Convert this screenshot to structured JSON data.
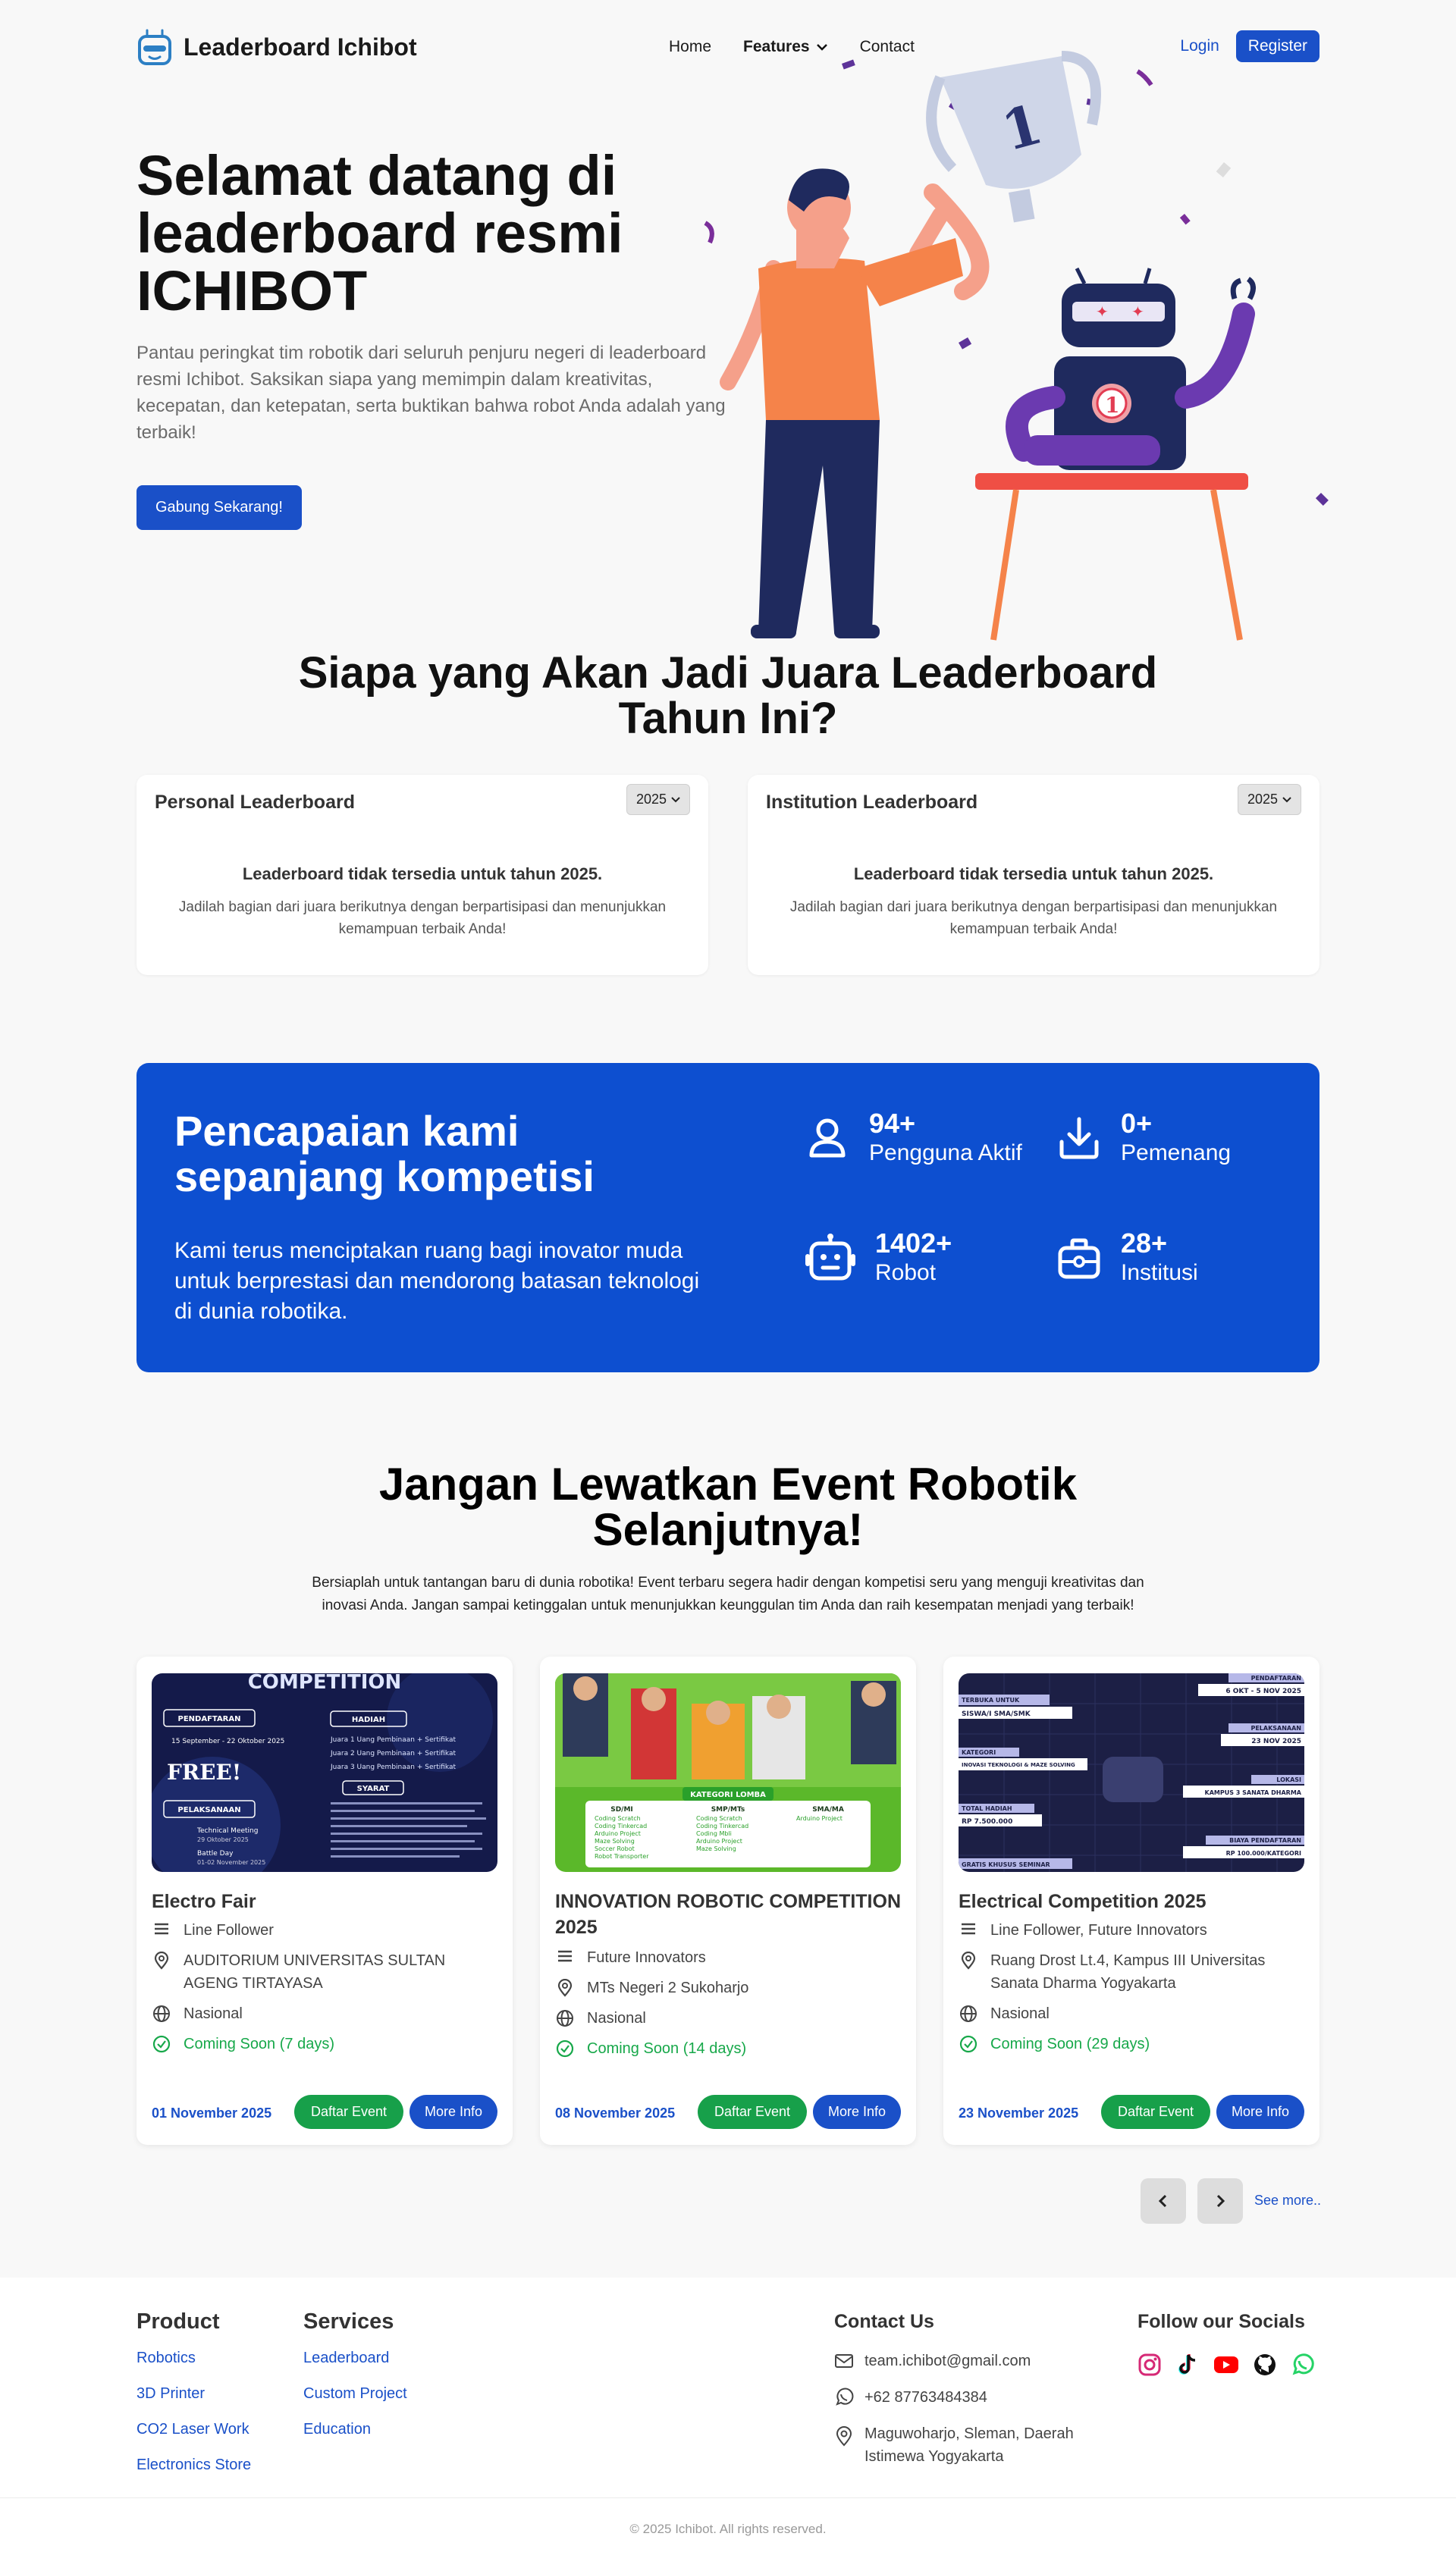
{
  "nav": {
    "brand": "Leaderboard Ichibot",
    "home": "Home",
    "features": "Features",
    "contact": "Contact",
    "login": "Login",
    "register": "Register"
  },
  "hero": {
    "title": "Selamat datang di leaderboard resmi ICHIBOT",
    "description": "Pantau peringkat tim robotik dari seluruh penjuru negeri di leaderboard resmi Ichibot. Saksikan siapa yang memimpin dalam kreativitas, kecepatan, dan ketepatan, serta buktikan bahwa robot Anda adalah yang terbaik!",
    "cta": "Gabung Sekarang!",
    "trophy_number": "1",
    "badge_number": "1"
  },
  "leaderboard": {
    "title": "Siapa yang Akan Jadi Juara Leaderboard Tahun Ini?",
    "cards": [
      {
        "title": "Personal Leaderboard",
        "year": "2025",
        "empty": "Leaderboard tidak tersedia untuk tahun 2025.",
        "sub": "Jadilah bagian dari juara berikutnya dengan berpartisipasi dan menunjukkan kemampuan terbaik Anda!"
      },
      {
        "title": "Institution Leaderboard",
        "year": "2025",
        "empty": "Leaderboard tidak tersedia untuk tahun 2025.",
        "sub": "Jadilah bagian dari juara berikutnya dengan berpartisipasi dan menunjukkan kemampuan terbaik Anda!"
      }
    ]
  },
  "stats": {
    "title": "Pencapaian kami sepanjang kompetisi",
    "description": "Kami terus menciptakan ruang bagi inovator muda untuk berprestasi dan mendorong batasan teknologi di dunia robotika.",
    "items": [
      {
        "value": "94+",
        "label": "Pengguna Aktif",
        "icon": "user-icon"
      },
      {
        "value": "0+",
        "label": "Pemenang",
        "icon": "download-icon"
      },
      {
        "value": "1402+",
        "label": "Robot",
        "icon": "robot-icon"
      },
      {
        "value": "28+",
        "label": "Institusi",
        "icon": "briefcase-icon"
      }
    ]
  },
  "events": {
    "title": "Jangan Lewatkan Event Robotik Selanjutnya!",
    "description": "Bersiaplah untuk tantangan baru di dunia robotika! Event terbaru segera hadir dengan kompetisi seru yang menguji kreativitas dan inovasi Anda. Jangan sampai ketinggalan untuk menunjukkan keunggulan tim Anda dan raih kesempatan menjadi yang terbaik!",
    "daftar_label": "Daftar Event",
    "info_label": "More Info",
    "see_more": "See more..",
    "items": [
      {
        "name": "Electro Fair",
        "categories": "Line Follower",
        "location": "AUDITORIUM UNIVERSITAS SULTAN AGENG TIRTAYASA",
        "scope": "Nasional",
        "status": "Coming Soon (7 days)",
        "date": "01 November 2025",
        "poster": {
          "heading": "COMPETITION",
          "pendaftaran": "PENDAFTARAN",
          "pendaftaran_date": "15 September - 22 Oktober 2025",
          "free": "FREE!",
          "pelaksanaan": "PELAKSANAAN",
          "hadiah": "HADIAH",
          "syarat": "SYARAT",
          "tm": "Technical Meeting",
          "tm_date": "29 Oktober 2025",
          "battle": "Battle Day",
          "battle_date": "01-02 November 2025",
          "prize1": "Juara 1 Uang Pembinaan + Sertifikat",
          "prize2": "Juara 2 Uang Pembinaan + Sertifikat",
          "prize3": "Juara 3 Uang Pembinaan + Sertifikat"
        }
      },
      {
        "name": "INNOVATION ROBOTIC COMPETITION 2025",
        "categories": "Future Innovators",
        "location": "MTs Negeri 2 Sukoharjo",
        "scope": "Nasional",
        "status": "Coming Soon (14 days)",
        "date": "08 November 2025",
        "poster": {
          "kategori": "KATEGORI LOMBA",
          "col1": "SD/MI",
          "col2": "SMP/MTs",
          "col3": "SMA/MA",
          "items1": [
            "Coding Scratch",
            "Coding Tinkercad",
            "Arduino Project",
            "Maze Solving",
            "Soccer Robot",
            "Robot Transporter"
          ],
          "items2": [
            "Coding Scratch",
            "Coding Tinkercad",
            "Coding Mbli",
            "Arduino Project",
            "Maze Solving"
          ],
          "items3": [
            "Arduino Project"
          ]
        }
      },
      {
        "name": "Electrical Competition 2025",
        "categories": "Line Follower, Future Innovators",
        "location": "Ruang Drost Lt.4, Kampus III Universitas Sanata Dharma Yogyakarta",
        "scope": "Nasional",
        "status": "Coming Soon (29 days)",
        "date": "23 November 2025",
        "poster": {
          "pendaftaran": "PENDAFTARAN",
          "pendaftaran_date": "6 OKT - 5 NOV 2025",
          "terbuka": "TERBUKA UNTUK",
          "terbuka_val": "SISWA/I SMA/SMK",
          "pelaksanaan": "PELAKSANAAN",
          "pelaksanaan_date": "23 NOV 2025",
          "kategori": "KATEGORI",
          "kategori_val": "INOVASI TEKNOLOGI & MAZE SOLVING",
          "lokasi": "LOKASI",
          "lokasi_val": "KAMPUS 3 SANATA DHARMA",
          "hadiah": "TOTAL HADIAH",
          "hadiah_val": "RP 7.500.000",
          "biaya": "BIAYA PENDAFTARAN",
          "biaya_val": "RP 100.000/KATEGORI",
          "seminar": "GRATIS KHUSUS SEMINAR"
        }
      }
    ]
  },
  "footer": {
    "product_title": "Product",
    "product_links": [
      "Robotics",
      "3D Printer",
      "CO2 Laser Work",
      "Electronics Store"
    ],
    "services_title": "Services",
    "services_links": [
      "Leaderboard",
      "Custom Project",
      "Education"
    ],
    "contact_title": "Contact Us",
    "email": "team.ichibot@gmail.com",
    "phone": "+62 87763484384",
    "address": "Maguwoharjo, Sleman, Daerah Istimewa Yogyakarta",
    "socials_title": "Follow our Socials",
    "socials": [
      "instagram-icon",
      "tiktok-icon",
      "youtube-icon",
      "github-icon",
      "whatsapp-icon"
    ],
    "copyright": "© 2025 Ichibot. All rights reserved."
  },
  "colors": {
    "primary": "#1a50c8",
    "stats_bg": "#0d4fd0",
    "success": "#17a04a",
    "background": "#f8f8f8"
  }
}
